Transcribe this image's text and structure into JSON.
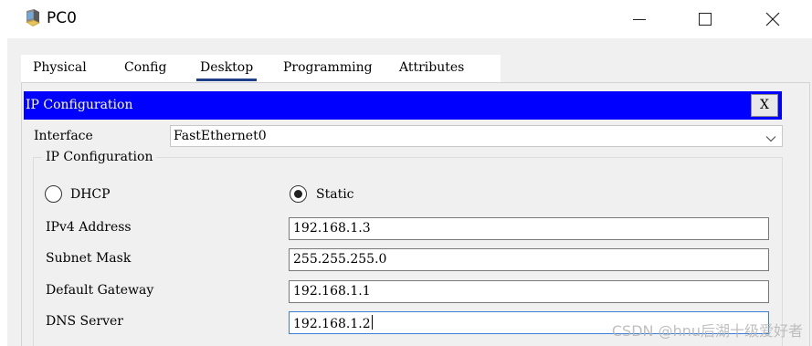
{
  "window": {
    "title": "PC0",
    "app_icon": "pc-app-icon",
    "controls": [
      "minimize-icon",
      "maximize-icon",
      "close-icon"
    ]
  },
  "tabs": [
    {
      "label": "Physical",
      "active": false
    },
    {
      "label": "Config",
      "active": false
    },
    {
      "label": "Desktop",
      "active": true
    },
    {
      "label": "Programming",
      "active": false
    },
    {
      "label": "Attributes",
      "active": false
    }
  ],
  "ip_config": {
    "header_title": "IP Configuration",
    "close_label": "X",
    "interface_label": "Interface",
    "interface_value": "FastEthernet0",
    "group_title": "IP Configuration",
    "mode": {
      "dhcp_label": "DHCP",
      "static_label": "Static",
      "selected": "Static"
    },
    "fields": [
      {
        "label": "IPv4 Address",
        "value": "192.168.1.3"
      },
      {
        "label": "Subnet Mask",
        "value": "255.255.255.0"
      },
      {
        "label": "Default Gateway",
        "value": "192.168.1.1"
      },
      {
        "label": "DNS Server",
        "value": "192.168.1.2"
      }
    ]
  },
  "watermark": "CSDN @hnu后湖十级爱好者",
  "colors": {
    "header_bg": "#0000ff",
    "tab_underline": "#1f3f8a",
    "panel_bg": "#f0f0f0"
  }
}
